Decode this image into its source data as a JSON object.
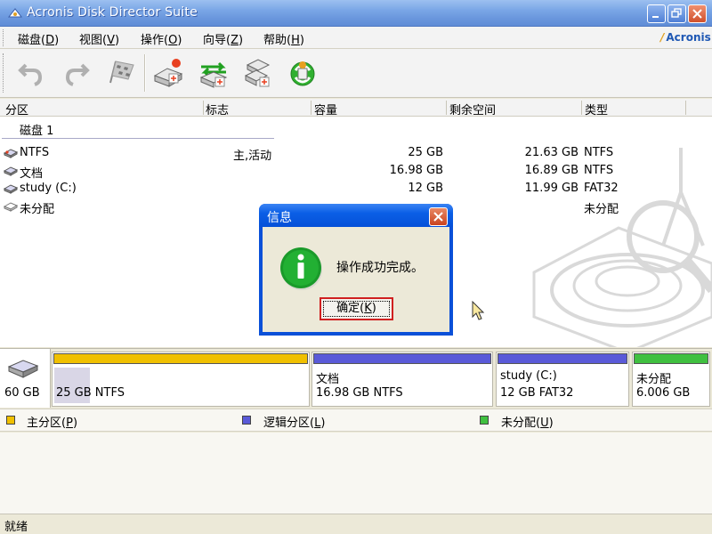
{
  "window": {
    "title": "Acronis Disk Director Suite"
  },
  "menubar": {
    "items": [
      {
        "label": "磁盘",
        "key": "D"
      },
      {
        "label": "视图",
        "key": "V"
      },
      {
        "label": "操作",
        "key": "O"
      },
      {
        "label": "向导",
        "key": "Z"
      },
      {
        "label": "帮助",
        "key": "H"
      }
    ],
    "brand": "Acronis"
  },
  "toolbar": {
    "buttons": [
      "undo-icon",
      "redo-icon",
      "commit-flag-icon",
      "create-partition-icon",
      "copy-partition-icon",
      "resize-partition-icon",
      "recovery-icon"
    ]
  },
  "list": {
    "columns": [
      "分区",
      "标志",
      "容量",
      "剩余空间",
      "类型"
    ],
    "disk_label": "磁盘 1",
    "rows": [
      {
        "name": "NTFS",
        "flags": "主,活动",
        "capacity": "25 GB",
        "free": "21.63 GB",
        "type": "NTFS"
      },
      {
        "name": "文档",
        "flags": "",
        "capacity": "16.98 GB",
        "free": "16.89 GB",
        "type": "NTFS"
      },
      {
        "name": "study (C:)",
        "flags": "",
        "capacity": "12 GB",
        "free": "11.99 GB",
        "type": "FAT32"
      },
      {
        "name": "未分配",
        "flags": "",
        "capacity": "",
        "free": "",
        "type": "未分配"
      }
    ]
  },
  "dialog": {
    "title": "信息",
    "message": "操作成功完成。",
    "ok_label": "确定",
    "ok_key": "K"
  },
  "diskmap": {
    "disk_size": "60 GB",
    "partitions": [
      {
        "line1": "",
        "line2": "25 GB  NTFS",
        "color": "#f0c000",
        "usage": 0.14
      },
      {
        "line1": "文档",
        "line2": "16.98 GB  NTFS",
        "color": "#5a5ad8"
      },
      {
        "line1": "study (C:)",
        "line2": "12 GB  FAT32",
        "color": "#5a5ad8"
      },
      {
        "line1": "未分配",
        "line2": "6.006 GB",
        "color": "#40c040"
      }
    ]
  },
  "legend": {
    "items": [
      {
        "label": "主分区",
        "key": "P",
        "color": "#f0c000"
      },
      {
        "label": "逻辑分区",
        "key": "L",
        "color": "#5a5ad8"
      },
      {
        "label": "未分配",
        "key": "U",
        "color": "#40c040"
      }
    ]
  },
  "status": {
    "text": "就绪"
  }
}
